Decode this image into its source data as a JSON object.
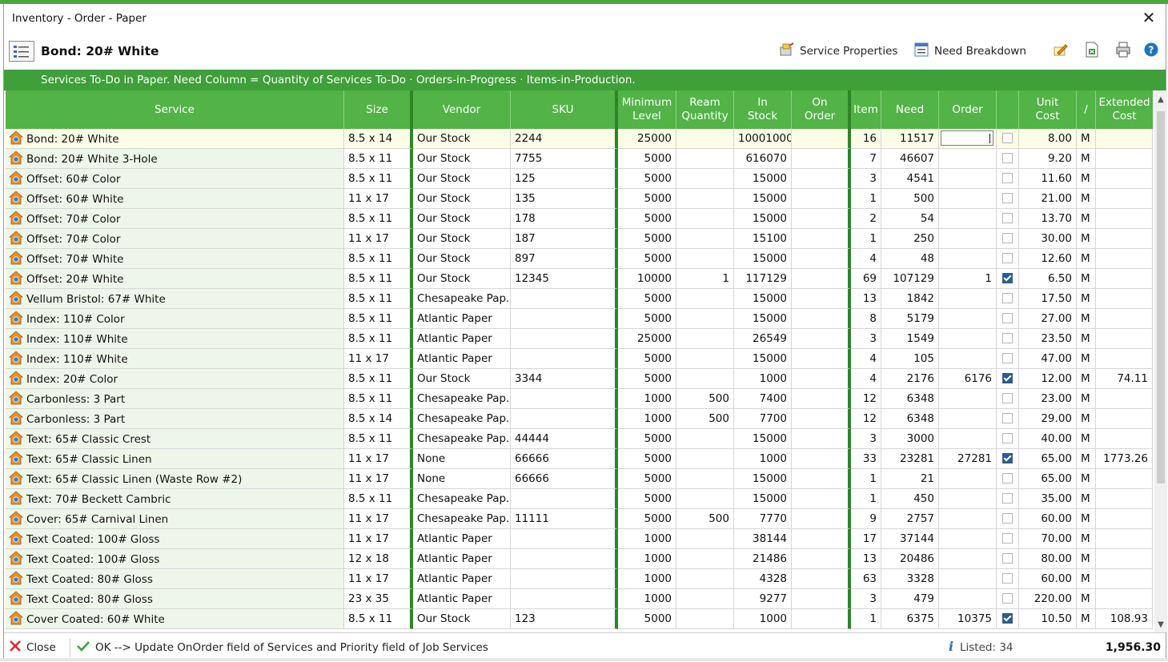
{
  "window": {
    "title": "Inventory - Order - Paper",
    "close_glyph": "✕"
  },
  "header": {
    "service_name": "Bond: 20# White",
    "service_properties_label": "Service Properties",
    "need_breakdown_label": "Need Breakdown"
  },
  "banner": {
    "text": "Services To-Do in Paper. Need Column = Quantity of Services To-Do · Orders-in-Progress · Items-in-Production."
  },
  "grid": {
    "columns": {
      "service": "Service",
      "size": "Size",
      "vendor": "Vendor",
      "sku": "SKU",
      "min_level_1": "Minimum",
      "min_level_2": "Level",
      "ream_1": "Ream",
      "ream_2": "Quantity",
      "instock_1": "In",
      "instock_2": "Stock",
      "onorder_1": "On",
      "onorder_2": "Order",
      "item": "Item",
      "need": "Need",
      "order": "Order",
      "unit_cost_1": "Unit",
      "unit_cost_2": "Cost",
      "per": "/",
      "ext_cost_1": "Extended",
      "ext_cost_2": "Cost"
    },
    "rows": [
      {
        "service": "Bond: 20# White",
        "size": "8.5 x 14",
        "vendor": "Our Stock",
        "sku": "2244",
        "min": "25000",
        "ream": "",
        "instock": "10001000",
        "onorder": "",
        "item": "16",
        "need": "11517",
        "order": "",
        "checked": false,
        "unit": "8.00",
        "per": "M",
        "ext": ""
      },
      {
        "service": "Bond: 20# White 3-Hole",
        "size": "8.5 x 11",
        "vendor": "Our Stock",
        "sku": "7755",
        "min": "5000",
        "ream": "",
        "instock": "616070",
        "onorder": "",
        "item": "7",
        "need": "46607",
        "order": "",
        "checked": false,
        "unit": "9.20",
        "per": "M",
        "ext": ""
      },
      {
        "service": "Offset: 60# Color",
        "size": "8.5 x 11",
        "vendor": "Our Stock",
        "sku": "125",
        "min": "5000",
        "ream": "",
        "instock": "15000",
        "onorder": "",
        "item": "3",
        "need": "4541",
        "order": "",
        "checked": false,
        "unit": "11.60",
        "per": "M",
        "ext": ""
      },
      {
        "service": "Offset: 60# White",
        "size": "11 x 17",
        "vendor": "Our Stock",
        "sku": "135",
        "min": "5000",
        "ream": "",
        "instock": "15000",
        "onorder": "",
        "item": "1",
        "need": "500",
        "order": "",
        "checked": false,
        "unit": "21.00",
        "per": "M",
        "ext": ""
      },
      {
        "service": "Offset: 70# Color",
        "size": "8.5 x 11",
        "vendor": "Our Stock",
        "sku": "178",
        "min": "5000",
        "ream": "",
        "instock": "15000",
        "onorder": "",
        "item": "2",
        "need": "54",
        "order": "",
        "checked": false,
        "unit": "13.70",
        "per": "M",
        "ext": ""
      },
      {
        "service": "Offset: 70# Color",
        "size": "11 x 17",
        "vendor": "Our Stock",
        "sku": "187",
        "min": "5000",
        "ream": "",
        "instock": "15100",
        "onorder": "",
        "item": "1",
        "need": "250",
        "order": "",
        "checked": false,
        "unit": "30.00",
        "per": "M",
        "ext": ""
      },
      {
        "service": "Offset: 70# White",
        "size": "8.5 x 11",
        "vendor": "Our Stock",
        "sku": "897",
        "min": "5000",
        "ream": "",
        "instock": "15000",
        "onorder": "",
        "item": "4",
        "need": "48",
        "order": "",
        "checked": false,
        "unit": "12.60",
        "per": "M",
        "ext": ""
      },
      {
        "service": "Offset: 20# White",
        "size": "8.5 x 11",
        "vendor": "Our Stock",
        "sku": "12345",
        "min": "10000",
        "ream": "1",
        "instock": "117129",
        "onorder": "",
        "item": "69",
        "need": "107129",
        "order": "1",
        "checked": true,
        "unit": "6.50",
        "per": "M",
        "ext": ""
      },
      {
        "service": "Vellum Bristol: 67# White",
        "size": "8.5 x 11",
        "vendor": "Chesapeake Pap...",
        "sku": "",
        "min": "5000",
        "ream": "",
        "instock": "15000",
        "onorder": "",
        "item": "13",
        "need": "1842",
        "order": "",
        "checked": false,
        "unit": "17.50",
        "per": "M",
        "ext": ""
      },
      {
        "service": "Index: 110# Color",
        "size": "8.5 x 11",
        "vendor": "Atlantic Paper",
        "sku": "",
        "min": "5000",
        "ream": "",
        "instock": "15000",
        "onorder": "",
        "item": "8",
        "need": "5179",
        "order": "",
        "checked": false,
        "unit": "27.00",
        "per": "M",
        "ext": ""
      },
      {
        "service": "Index: 110# White",
        "size": "8.5 x 11",
        "vendor": "Atlantic Paper",
        "sku": "",
        "min": "25000",
        "ream": "",
        "instock": "26549",
        "onorder": "",
        "item": "3",
        "need": "1549",
        "order": "",
        "checked": false,
        "unit": "23.50",
        "per": "M",
        "ext": ""
      },
      {
        "service": "Index: 110# White",
        "size": "11 x 17",
        "vendor": "Atlantic Paper",
        "sku": "",
        "min": "5000",
        "ream": "",
        "instock": "15000",
        "onorder": "",
        "item": "4",
        "need": "105",
        "order": "",
        "checked": false,
        "unit": "47.00",
        "per": "M",
        "ext": ""
      },
      {
        "service": "Index: 20# Color",
        "size": "8.5 x 11",
        "vendor": "Our Stock",
        "sku": "3344",
        "min": "5000",
        "ream": "",
        "instock": "1000",
        "onorder": "",
        "item": "4",
        "need": "2176",
        "order": "6176",
        "checked": true,
        "unit": "12.00",
        "per": "M",
        "ext": "74.11"
      },
      {
        "service": "Carbonless: 3 Part",
        "size": "8.5 x 11",
        "vendor": "Chesapeake Pap...",
        "sku": "",
        "min": "1000",
        "ream": "500",
        "instock": "7400",
        "onorder": "",
        "item": "12",
        "need": "6348",
        "order": "",
        "checked": false,
        "unit": "23.00",
        "per": "M",
        "ext": ""
      },
      {
        "service": "Carbonless: 3 Part",
        "size": "8.5 x 14",
        "vendor": "Chesapeake Pap...",
        "sku": "",
        "min": "1000",
        "ream": "500",
        "instock": "7700",
        "onorder": "",
        "item": "12",
        "need": "6348",
        "order": "",
        "checked": false,
        "unit": "29.00",
        "per": "M",
        "ext": ""
      },
      {
        "service": "Text: 65# Classic Crest",
        "size": "8.5 x 11",
        "vendor": "Chesapeake Pap...",
        "sku": "44444",
        "min": "5000",
        "ream": "",
        "instock": "15000",
        "onorder": "",
        "item": "3",
        "need": "3000",
        "order": "",
        "checked": false,
        "unit": "40.00",
        "per": "M",
        "ext": ""
      },
      {
        "service": "Text: 65# Classic Linen",
        "size": "11 x 17",
        "vendor": "None",
        "sku": "66666",
        "min": "5000",
        "ream": "",
        "instock": "1000",
        "onorder": "",
        "item": "33",
        "need": "23281",
        "order": "27281",
        "checked": true,
        "unit": "65.00",
        "per": "M",
        "ext": "1773.26"
      },
      {
        "service": "Text: 65# Classic Linen (Waste Row #2)",
        "size": "11 x 17",
        "vendor": "None",
        "sku": "66666",
        "min": "5000",
        "ream": "",
        "instock": "15000",
        "onorder": "",
        "item": "1",
        "need": "21",
        "order": "",
        "checked": false,
        "unit": "65.00",
        "per": "M",
        "ext": ""
      },
      {
        "service": "Text: 70# Beckett Cambric",
        "size": "8.5 x 11",
        "vendor": "Chesapeake Pap...",
        "sku": "",
        "min": "5000",
        "ream": "",
        "instock": "15000",
        "onorder": "",
        "item": "1",
        "need": "450",
        "order": "",
        "checked": false,
        "unit": "35.00",
        "per": "M",
        "ext": ""
      },
      {
        "service": "Cover: 65# Carnival Linen",
        "size": "11 x 17",
        "vendor": "Chesapeake Pap...",
        "sku": "11111",
        "min": "5000",
        "ream": "500",
        "instock": "7770",
        "onorder": "",
        "item": "9",
        "need": "2757",
        "order": "",
        "checked": false,
        "unit": "60.00",
        "per": "M",
        "ext": ""
      },
      {
        "service": "Text Coated: 100# Gloss",
        "size": "11 x 17",
        "vendor": "Atlantic Paper",
        "sku": "",
        "min": "1000",
        "ream": "",
        "instock": "38144",
        "onorder": "",
        "item": "17",
        "need": "37144",
        "order": "",
        "checked": false,
        "unit": "70.00",
        "per": "M",
        "ext": ""
      },
      {
        "service": "Text Coated: 100# Gloss",
        "size": "12 x 18",
        "vendor": "Atlantic Paper",
        "sku": "",
        "min": "1000",
        "ream": "",
        "instock": "21486",
        "onorder": "",
        "item": "13",
        "need": "20486",
        "order": "",
        "checked": false,
        "unit": "80.00",
        "per": "M",
        "ext": ""
      },
      {
        "service": "Text Coated: 80# Gloss",
        "size": "11 x 17",
        "vendor": "Atlantic Paper",
        "sku": "",
        "min": "1000",
        "ream": "",
        "instock": "4328",
        "onorder": "",
        "item": "63",
        "need": "3328",
        "order": "",
        "checked": false,
        "unit": "60.00",
        "per": "M",
        "ext": ""
      },
      {
        "service": "Text Coated: 80# Gloss",
        "size": "23 x 35",
        "vendor": "Atlantic Paper",
        "sku": "",
        "min": "1000",
        "ream": "",
        "instock": "9277",
        "onorder": "",
        "item": "3",
        "need": "479",
        "order": "",
        "checked": false,
        "unit": "220.00",
        "per": "M",
        "ext": ""
      },
      {
        "service": "Cover Coated: 60# White",
        "size": "8.5 x 11",
        "vendor": "Our Stock",
        "sku": "123",
        "min": "5000",
        "ream": "",
        "instock": "1000",
        "onorder": "",
        "item": "1",
        "need": "6375",
        "order": "10375",
        "checked": true,
        "unit": "10.50",
        "per": "M",
        "ext": "108.93"
      }
    ]
  },
  "footer": {
    "close_label": "Close",
    "ok_label": "OK --> Update OnOrder field of Services and Priority field of Job Services",
    "listed_label": "Listed: 34",
    "total": "1,956.30"
  },
  "colors": {
    "accent_green": "#3f9f38",
    "header_green": "#52b347",
    "selected_row": "#fdfce6",
    "service_cell": "#edf7e9"
  }
}
